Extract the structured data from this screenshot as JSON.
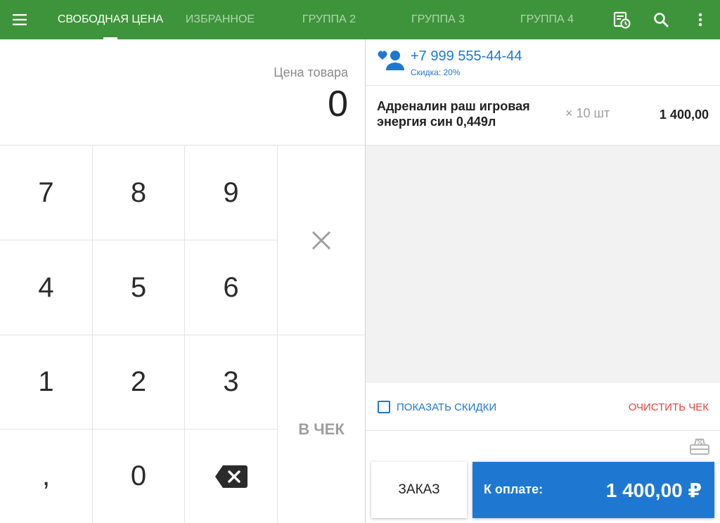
{
  "topbar": {
    "menu_icon": "hamburger-menu-icon",
    "tabs": [
      {
        "label": "СВОБОДНАЯ ЦЕНА",
        "active": true
      },
      {
        "label": "ИЗБРАННОЕ",
        "active": false
      },
      {
        "label": "ГРУППА 2",
        "active": false
      },
      {
        "label": "ГРУППА 3",
        "active": false
      },
      {
        "label": "ГРУППА 4",
        "active": false
      }
    ],
    "icons": [
      "receipt-history-icon",
      "search-icon",
      "more-vert-icon"
    ],
    "color": "#3e943a"
  },
  "price": {
    "label": "Цена товара",
    "value": "0"
  },
  "keypad": {
    "keys": [
      "7",
      "8",
      "9",
      "4",
      "5",
      "6",
      "1",
      "2",
      "3",
      ",",
      "0"
    ],
    "backspace_icon": "backspace-icon",
    "multiply_icon": "multiply-icon",
    "add_to_check": "В ЧЕК"
  },
  "customer": {
    "icon": "loyal-customer-icon",
    "phone": "+7 999 555-44-44",
    "discount": "Скидка: 20%"
  },
  "items": [
    {
      "name": "Адреналин раш игровая энергия син 0,449л",
      "qty": "× 10 шт",
      "sum": "1 400,00"
    }
  ],
  "actions": {
    "show_discounts": "ПОКАЗАТЬ СКИДКИ",
    "clear_check": "ОЧИСТИТЬ ЧЕК",
    "discount_icon": "discount-register-icon"
  },
  "footer": {
    "order": "ЗАКАЗ",
    "pay_label": "К оплате:",
    "pay_amount": "1 400,00 ₽",
    "pay_color": "#1e78d2"
  }
}
